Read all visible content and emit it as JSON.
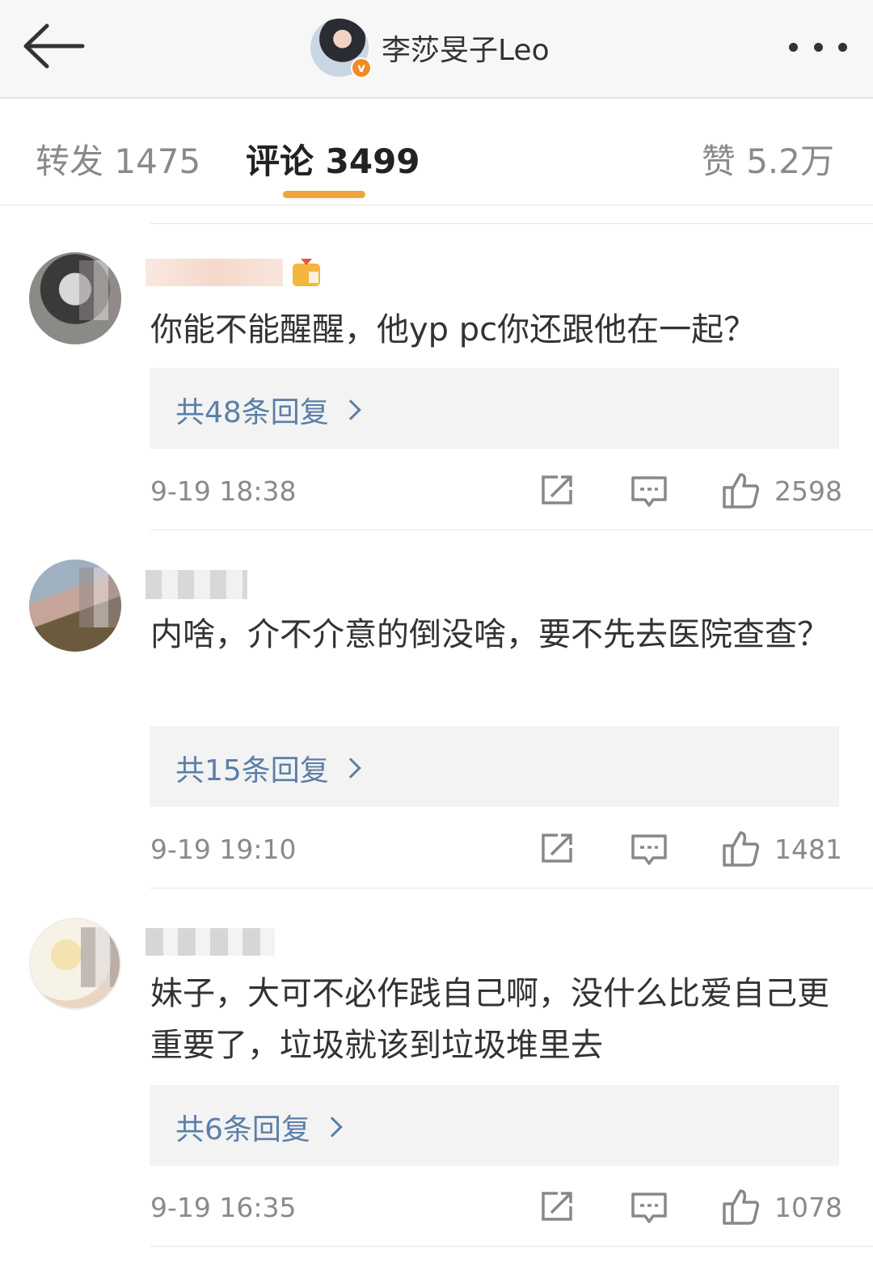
{
  "header": {
    "title": "李莎旻子Leo",
    "verified_badge": "v",
    "icons": {
      "back": "arrow-left-icon",
      "more": "more-dots-icon"
    }
  },
  "tabs": {
    "repost": "转发 1475",
    "comments": "评论 3499",
    "likes": "赞 5.2万",
    "active": "comments",
    "accent_color": "#f0a43a"
  },
  "comments": [
    {
      "text": "你能不能醒醒，他yp pc你还跟他在一起？",
      "replies": "共48条回复",
      "time": "9-19 18:38",
      "likes": "2598"
    },
    {
      "text": "内啥，介不介意的倒没啥，要不先去医院查查？",
      "replies": "共15条回复",
      "time": "9-19 19:10",
      "likes": "1481"
    },
    {
      "text": "妹子，大可不必作践自己啊，没什么比爱自己更重要了，垃圾就该到垃圾堆里去",
      "replies": "共6条回复",
      "time": "9-19 16:35",
      "likes": "1078"
    }
  ],
  "colors": {
    "reply_link": "#5b7fa8",
    "meta_text": "#8a8a8a",
    "reply_bg": "#f3f3f3"
  }
}
